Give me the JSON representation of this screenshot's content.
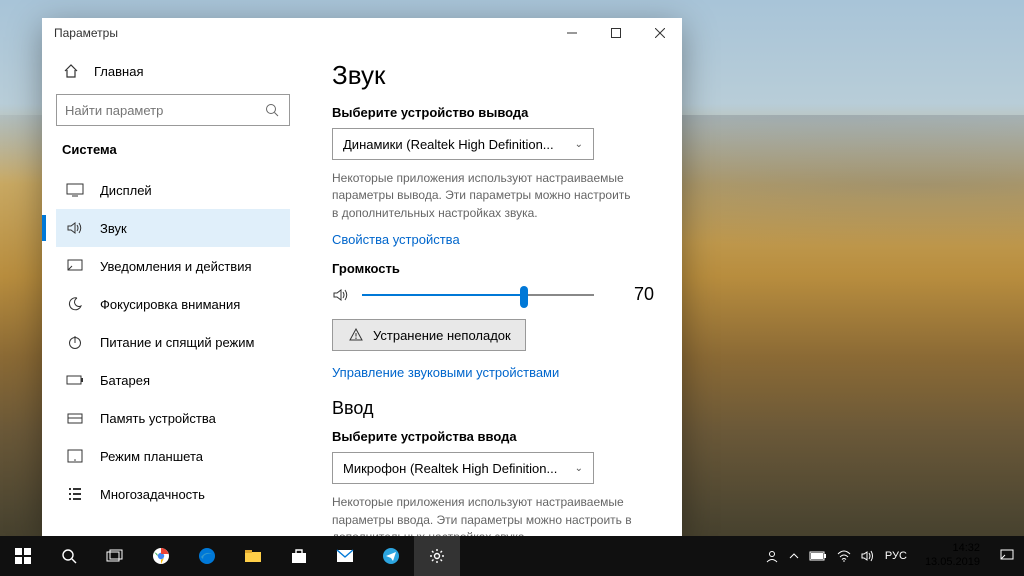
{
  "window": {
    "title": "Параметры"
  },
  "sidebar": {
    "home": "Главная",
    "search_placeholder": "Найти параметр",
    "category": "Система",
    "items": [
      {
        "id": "display",
        "label": "Дисплей"
      },
      {
        "id": "sound",
        "label": "Звук"
      },
      {
        "id": "notif",
        "label": "Уведомления и действия"
      },
      {
        "id": "focus",
        "label": "Фокусировка внимания"
      },
      {
        "id": "power",
        "label": "Питание и спящий режим"
      },
      {
        "id": "battery",
        "label": "Батарея"
      },
      {
        "id": "storage",
        "label": "Память устройства"
      },
      {
        "id": "tablet",
        "label": "Режим планшета"
      },
      {
        "id": "multi",
        "label": "Многозадачность"
      }
    ],
    "active_index": 1
  },
  "content": {
    "h1": "Звук",
    "output_label": "Выберите устройство вывода",
    "output_device": "Динамики (Realtek High Definition...",
    "output_help": "Некоторые приложения используют настраиваемые параметры вывода. Эти параметры можно настроить в дополнительных настройках звука.",
    "device_props": "Свойства устройства",
    "volume_label": "Громкость",
    "volume_value": 70,
    "troubleshoot": "Устранение неполадок",
    "manage_link": "Управление звуковыми устройствами",
    "h2_input": "Ввод",
    "input_label": "Выберите устройства ввода",
    "input_device": "Микрофон (Realtek High Definition...",
    "input_help": "Некоторые приложения используют настраиваемые параметры ввода. Эти параметры можно настроить в дополнительных настройках звука."
  },
  "taskbar": {
    "lang": "РУС",
    "time": "14:32",
    "date": "13.05.2019"
  }
}
